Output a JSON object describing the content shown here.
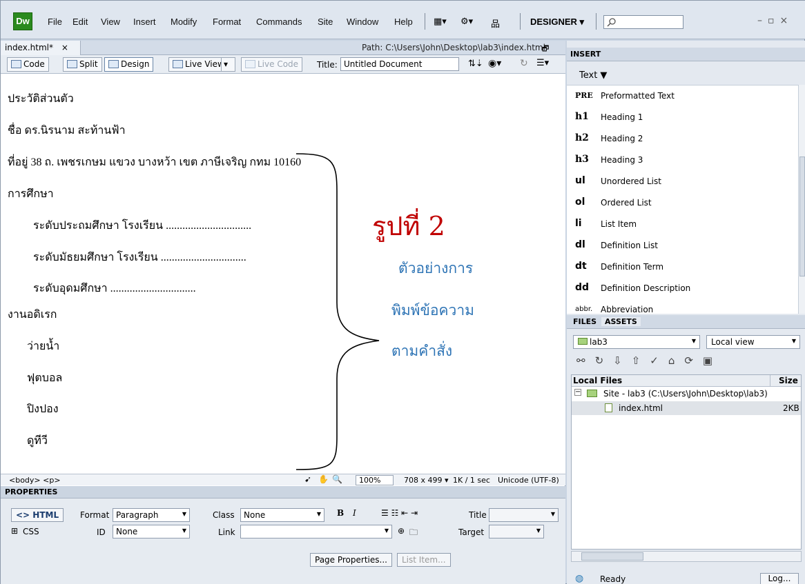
{
  "app": {
    "logo": "Dw",
    "workspace": "DESIGNER ▾"
  },
  "menu": [
    "File",
    "Edit",
    "View",
    "Insert",
    "Modify",
    "Format",
    "Commands",
    "Site",
    "Window",
    "Help"
  ],
  "document": {
    "tab": "index.html*",
    "tab_close": "×",
    "path": "Path: C:\\Users\\John\\Desktop\\lab3\\index.html",
    "views": {
      "code": "Code",
      "split": "Split",
      "design": "Design",
      "live_view": "Live View",
      "live_code": "Live Code"
    },
    "title_label": "Title:",
    "title_value": "Untitled Document"
  },
  "content": {
    "heading": "ประวัติส่วนตัว",
    "name": "ชื่อ ดร.นิรนาม สะท้านฟ้า",
    "address": "ที่อยู่ 38 ถ. เพชรเกษม แขวง บางหว้า เขต ภาษีเจริญ กทม 10160",
    "education": "การศึกษา",
    "edu_primary": "ระดับประถมศึกษา โรงเรียน ...............................",
    "edu_secondary": "ระดับมัธยมศึกษา โรงเรียน ...............................",
    "edu_higher": "ระดับอุดมศึกษา ...............................",
    "hobbies": "งานอดิเรก",
    "hobby_1": "ว่ายน้ำ",
    "hobby_2": "ฟุตบอล",
    "hobby_3": "ปิงปอง",
    "hobby_4": "ดูทีวี",
    "figure_label": "รูปที่ 2",
    "note_1": "ตัวอย่างการ",
    "note_2": "พิมพ์ข้อความ",
    "note_3": "ตามคำสั่ง"
  },
  "status": {
    "tags": "<body> <p>",
    "zoom": "100%",
    "size": "708 x 499 ▾",
    "speed": "1K / 1 sec",
    "encoding": "Unicode (UTF-8)"
  },
  "properties": {
    "header": "PROPERTIES",
    "html_btn": "<> HTML",
    "css_btn": "CSS",
    "format_label": "Format",
    "format_value": "Paragraph",
    "class_label": "Class",
    "class_value": "None",
    "id_label": "ID",
    "id_value": "None",
    "link_label": "Link",
    "title_label": "Title",
    "target_label": "Target",
    "page_properties": "Page Properties...",
    "list_item": "List Item..."
  },
  "insert": {
    "header": "INSERT",
    "category": "Text ▼",
    "items": [
      {
        "abbr": "PRE",
        "label": "Preformatted Text"
      },
      {
        "abbr": "h1",
        "label": "Heading 1"
      },
      {
        "abbr": "h2",
        "label": "Heading 2"
      },
      {
        "abbr": "h3",
        "label": "Heading 3"
      },
      {
        "abbr": "ul",
        "label": "Unordered List"
      },
      {
        "abbr": "ol",
        "label": "Ordered List"
      },
      {
        "abbr": "li",
        "label": "List Item"
      },
      {
        "abbr": "dl",
        "label": "Definition List"
      },
      {
        "abbr": "dt",
        "label": "Definition Term"
      },
      {
        "abbr": "dd",
        "label": "Definition Description"
      },
      {
        "abbr": "abbr.",
        "label": "Abbreviation"
      }
    ]
  },
  "files": {
    "tab_files": "FILES",
    "tab_assets": "ASSETS",
    "site": "lab3",
    "view": "Local view",
    "col_local": "Local Files",
    "col_size": "Size",
    "site_root": "Site - lab3 (C:\\Users\\John\\Desktop\\lab3)",
    "file_name": "index.html",
    "file_size": "2KB",
    "status": "Ready",
    "log_btn": "Log..."
  },
  "colors": {
    "accent_red": "#c00000",
    "accent_blue": "#2e74b5",
    "logo_green": "#2b8a1f"
  }
}
